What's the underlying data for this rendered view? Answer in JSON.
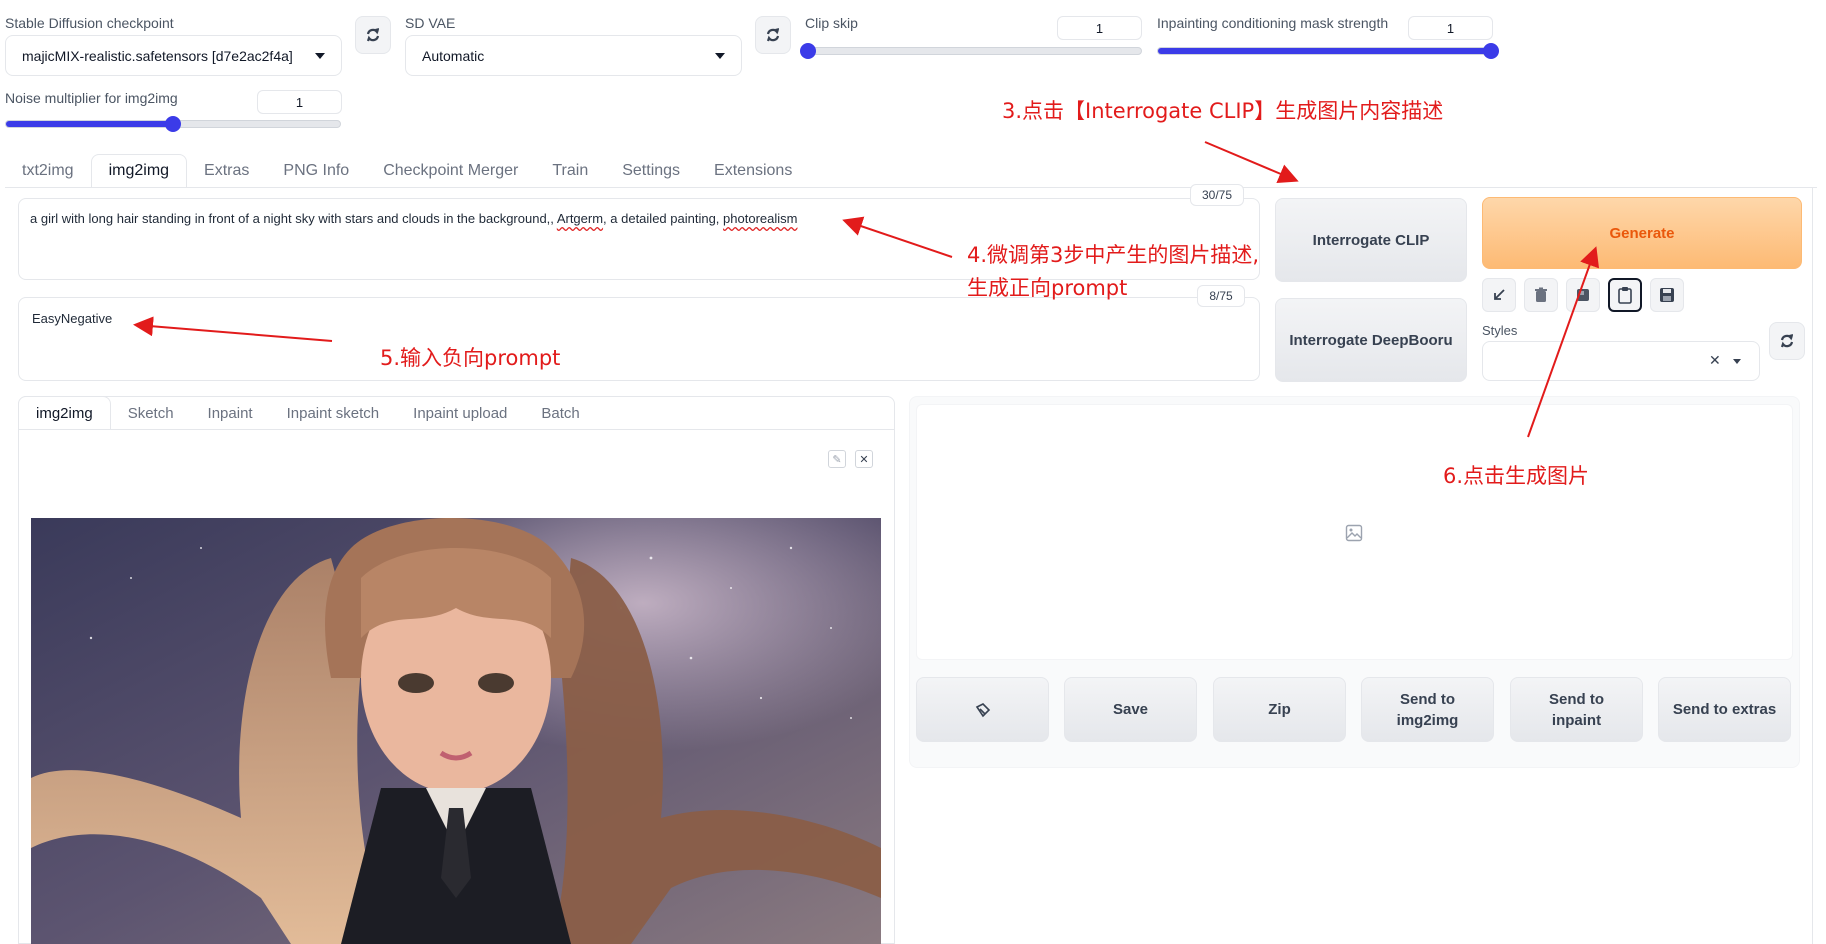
{
  "settings": {
    "checkpoint_label": "Stable Diffusion checkpoint",
    "checkpoint_value": "majicMIX-realistic.safetensors [d7e2ac2f4a]",
    "vae_label": "SD VAE",
    "vae_value": "Automatic",
    "clip_skip_label": "Clip skip",
    "clip_skip_value": "1",
    "clip_skip_level": 0.0,
    "inpaint_mask_label": "Inpainting conditioning mask strength",
    "inpaint_mask_value": "1",
    "inpaint_mask_level": 1.0,
    "noise_label": "Noise multiplier for img2img",
    "noise_value": "1",
    "noise_level": 0.5
  },
  "main_tabs": [
    "txt2img",
    "img2img",
    "Extras",
    "PNG Info",
    "Checkpoint Merger",
    "Train",
    "Settings",
    "Extensions"
  ],
  "main_tab_selected": "img2img",
  "prompt": {
    "text_a": "a girl with long hair standing in front of a night sky with stars and clouds in the background,, ",
    "text_b": "Artgerm",
    "text_c": ",  a detailed painting, ",
    "text_d": "photorealism",
    "token_count": "30/75"
  },
  "negative_prompt": {
    "text": "EasyNegative",
    "token_count": "8/75"
  },
  "buttons": {
    "interrogate_clip": "Interrogate CLIP",
    "interrogate_deepbooru": "Interrogate DeepBooru",
    "generate": "Generate"
  },
  "styles_label": "Styles",
  "sub_tabs": [
    "img2img",
    "Sketch",
    "Inpaint",
    "Inpaint sketch",
    "Inpaint upload",
    "Batch"
  ],
  "sub_tab_selected": "img2img",
  "output_buttons": {
    "save": "Save",
    "zip": "Zip",
    "send_img2img": "Send to img2img",
    "send_inpaint": "Send to inpaint",
    "send_extras": "Send to extras"
  },
  "annotations": {
    "step3": "3.点击【Interrogate CLIP】生成图片内容描述",
    "step4_line1": "4.微调第3步中产生的图片描述,",
    "step4_line2": "生成正向prompt",
    "step5": "5.输入负向prompt",
    "step6": "6.点击生成图片"
  },
  "colors": {
    "accent": "#3b3be8",
    "generate_bg": "#fdba74",
    "generate_text": "#ea580c",
    "annotation": "#e21b1b"
  }
}
